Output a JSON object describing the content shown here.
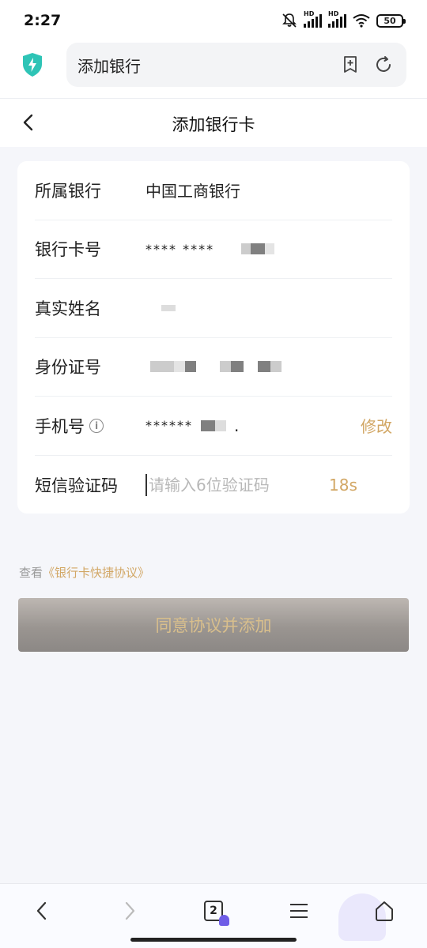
{
  "status_bar": {
    "time": "2:27",
    "battery": "50",
    "network_labels": [
      "HD",
      "HD"
    ]
  },
  "browser": {
    "url_text": "添加银行",
    "icons": [
      "shield-icon",
      "add-bookmark-icon",
      "refresh-icon"
    ]
  },
  "header": {
    "title": "添加银行卡"
  },
  "form": {
    "bank": {
      "label": "所属银行",
      "value": "中国工商银行"
    },
    "card_number": {
      "label": "银行卡号",
      "value": "**** ****"
    },
    "real_name": {
      "label": "真实姓名",
      "value": ""
    },
    "id_number": {
      "label": "身份证号",
      "value": ""
    },
    "phone": {
      "label": "手机号",
      "value": "******",
      "action": "修改",
      "suffix": "."
    },
    "sms_code": {
      "label": "短信验证码",
      "placeholder": "请输入6位验证码",
      "countdown": "18s"
    }
  },
  "agreement": {
    "prefix": "查看",
    "link": "《银行卡快捷协议》"
  },
  "submit": {
    "label": "同意协议并添加"
  },
  "bottom_nav": {
    "tab_count": "2"
  },
  "colors": {
    "accent": "#d2a765",
    "shield": "#2ec4b6",
    "badge": "#6f5de7"
  }
}
